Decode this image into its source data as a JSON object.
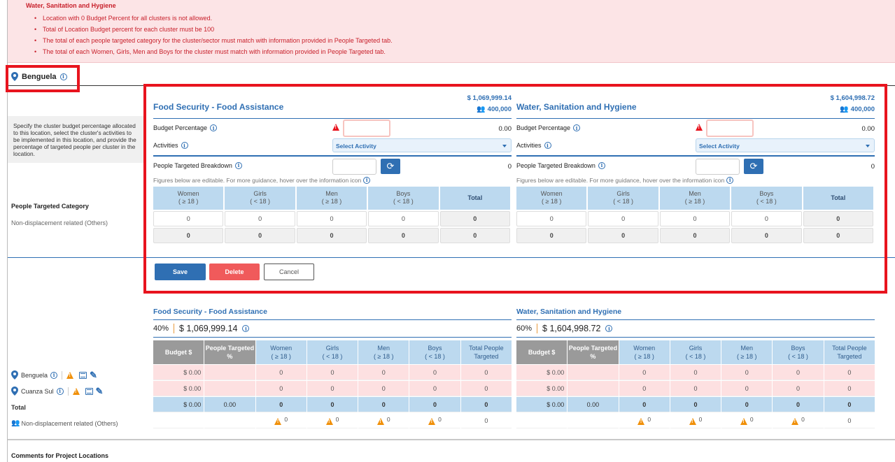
{
  "alert": {
    "title": "Water, Sanitation and Hygiene",
    "messages": [
      "Location with 0 Budget Percent for all clusters is not allowed.",
      "Total of Location Budget percent for each cluster must be 100",
      "The total of each people targeted category for the cluster/sector must match with information provided in People Targeted tab.",
      "The total of each Women, Girls, Men and Boys for the cluster must match with information provided in People Targeted tab."
    ]
  },
  "location": {
    "name": "Benguela",
    "icon": "map-pin-icon"
  },
  "hint": "Specify the cluster budget percentage allocated to this location, select the cluster's activities to be implemented in this location, and provide the percentage of targeted people per cluster in the location.",
  "people_targeted_category": {
    "label": "People Targeted Category",
    "value": "Non-displacement related (Others)"
  },
  "form_labels": {
    "budget_percentage": "Budget Percentage",
    "activities": "Activities",
    "select_activity": "Select Activity",
    "people_targeted_breakdown": "People Targeted Breakdown",
    "guidance": "Figures below are editable. For more guidance, hover over the information icon"
  },
  "breakdown_headers": [
    {
      "label": "Women",
      "sub": "( ≥ 18 )"
    },
    {
      "label": "Girls",
      "sub": "( < 18 )"
    },
    {
      "label": "Men",
      "sub": "( ≥ 18 )"
    },
    {
      "label": "Boys",
      "sub": "( < 18 )"
    },
    {
      "label": "Total",
      "sub": ""
    }
  ],
  "clusters": [
    {
      "name": "Food Security - Food Assistance",
      "amount": "$ 1,069,999.14",
      "people": "400,000",
      "budget_percentage_value": "",
      "budget_percentage_result": "0.00",
      "people_targeted_value": "",
      "people_targeted_result": "0",
      "editable_row": [
        "0",
        "0",
        "0",
        "0",
        "0"
      ],
      "total_row": [
        "0",
        "0",
        "0",
        "0",
        "0"
      ]
    },
    {
      "name": "Water, Sanitation and Hygiene",
      "amount": "$ 1,604,998.72",
      "people": "400,000",
      "budget_percentage_value": "",
      "budget_percentage_result": "0.00",
      "people_targeted_value": "",
      "people_targeted_result": "0",
      "editable_row": [
        "0",
        "0",
        "0",
        "0",
        "0"
      ],
      "total_row": [
        "0",
        "0",
        "0",
        "0",
        "0"
      ]
    }
  ],
  "actions": {
    "save": "Save",
    "delete": "Delete",
    "cancel": "Cancel"
  },
  "summary_headers": [
    "Budget $",
    "People Targeted %",
    "Women",
    "Girls",
    "Men",
    "Boys",
    "Total People Targeted"
  ],
  "summary_header_subs": [
    "",
    "",
    "( ≥ 18 )",
    "( < 18 )",
    "( ≥ 18 )",
    "( < 18 )",
    ""
  ],
  "summary_rows": [
    {
      "label": "Benguela",
      "type": "location"
    },
    {
      "label": "Cuanza Sul",
      "type": "location"
    },
    {
      "label": "Total",
      "type": "total"
    },
    {
      "label": "Non-displacement related (Others)",
      "type": "category"
    }
  ],
  "summary": [
    {
      "name": "Food Security - Food Assistance",
      "percent": "40%",
      "amount": "$ 1,069,999.14",
      "rows": [
        [
          "$ 0.00",
          "",
          "0",
          "0",
          "0",
          "0",
          "0"
        ],
        [
          "$ 0.00",
          "",
          "0",
          "0",
          "0",
          "0",
          "0"
        ],
        [
          "$ 0.00",
          "0.00",
          "0",
          "0",
          "0",
          "0",
          "0"
        ],
        [
          "",
          "",
          "0",
          "0",
          "0",
          "0",
          "0"
        ]
      ]
    },
    {
      "name": "Water, Sanitation and Hygiene",
      "percent": "60%",
      "amount": "$ 1,604,998.72",
      "rows": [
        [
          "$ 0.00",
          "",
          "0",
          "0",
          "0",
          "0",
          "0"
        ],
        [
          "$ 0.00",
          "",
          "0",
          "0",
          "0",
          "0",
          "0"
        ],
        [
          "$ 0.00",
          "0.00",
          "0",
          "0",
          "0",
          "0",
          "0"
        ],
        [
          "",
          "",
          "0",
          "0",
          "0",
          "0",
          "0"
        ]
      ]
    }
  ],
  "comments_title": "Comments for Project Locations",
  "colors": {
    "accent": "#2f6fb3",
    "error": "#c8202b",
    "warning": "#f0900a",
    "highlight_frame": "#e8141e"
  }
}
